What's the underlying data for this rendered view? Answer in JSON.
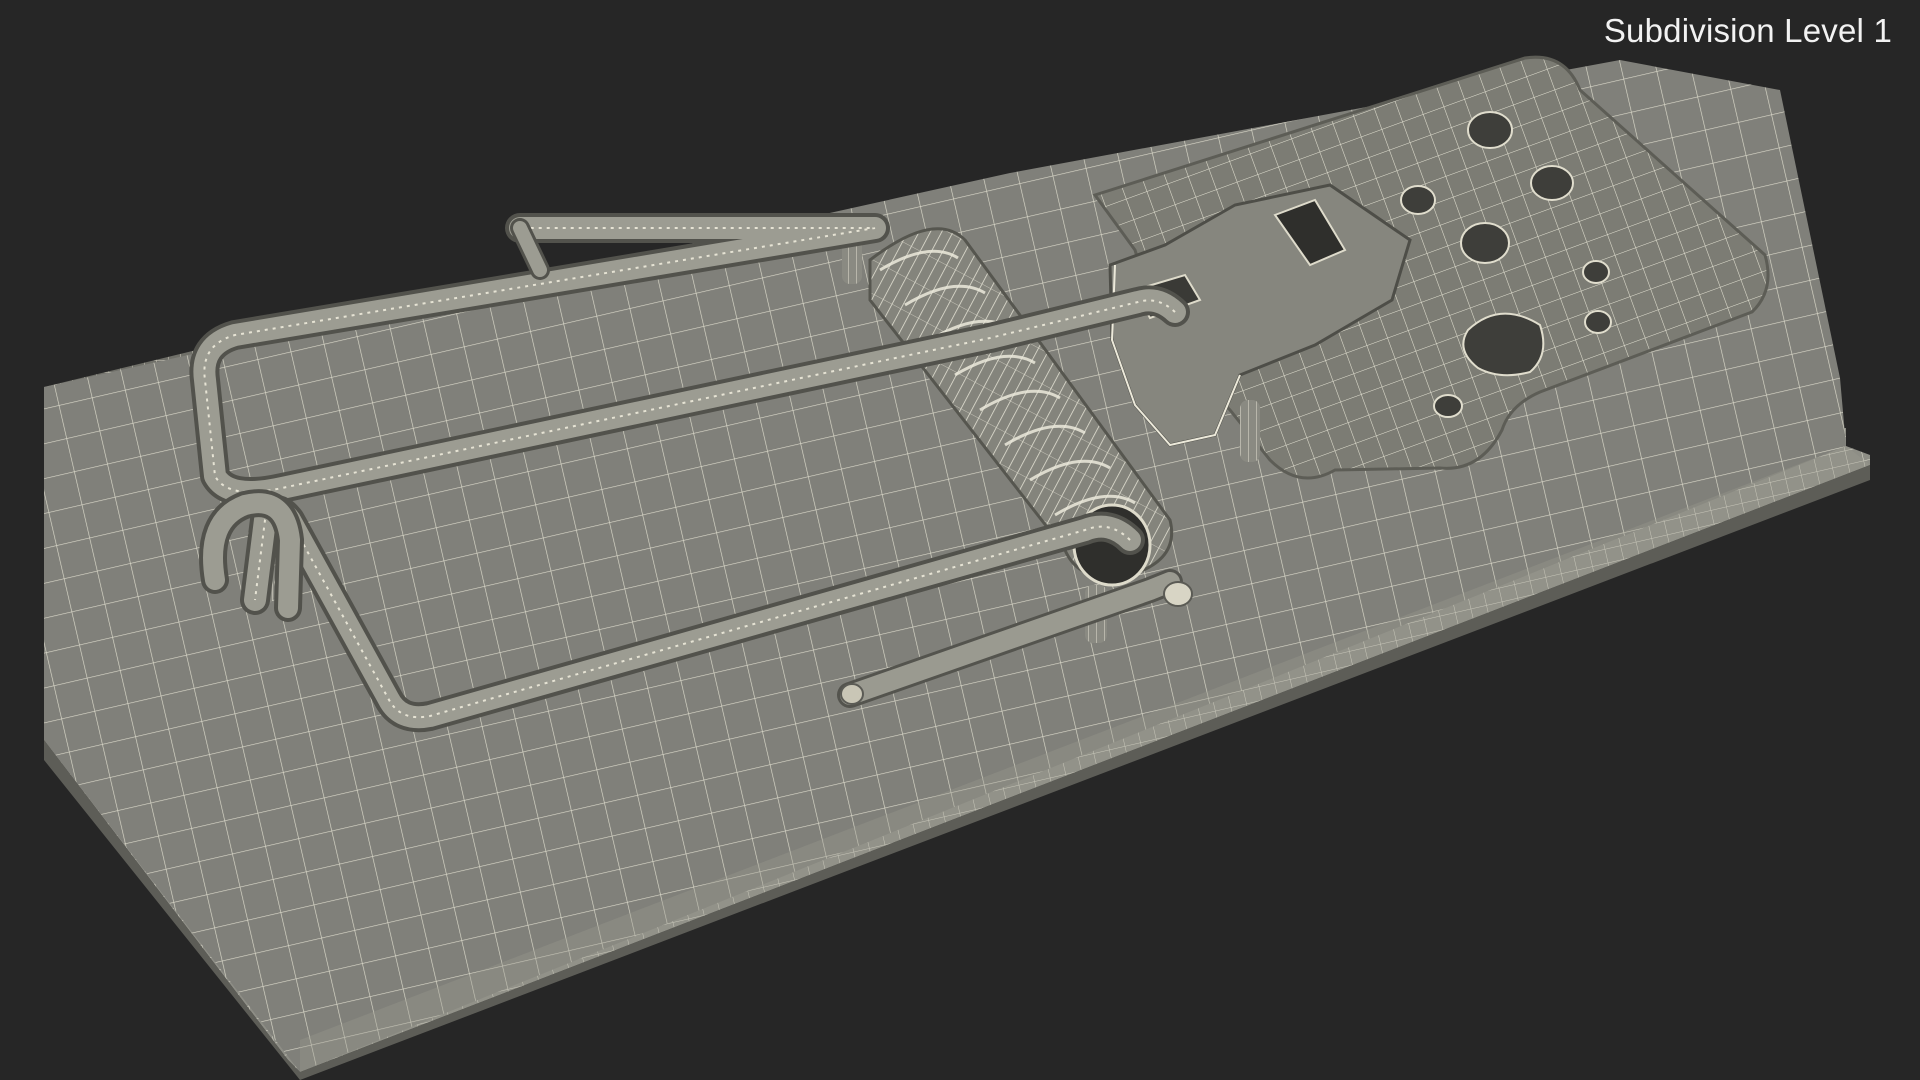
{
  "viewport": {
    "caption": "Subdivision Level 1",
    "background_color": "#262626"
  },
  "model": {
    "subject": "mousetrap",
    "display_mode": "wireframe",
    "surface_color": "#7d7d72",
    "wire_color": "#d9d6c6"
  }
}
